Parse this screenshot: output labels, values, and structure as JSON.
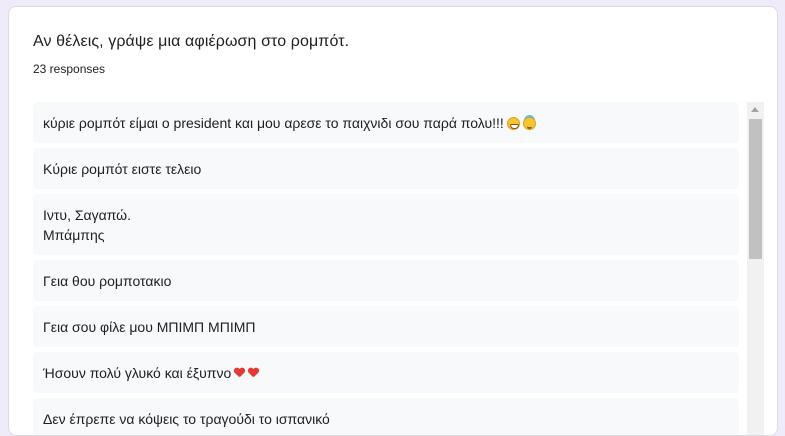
{
  "question": {
    "title": "Αν θέλεις, γράψε μια αφιέρωση στο ρομπότ.",
    "response_count": "23 responses"
  },
  "responses": [
    {
      "text": "κύριε ρομπότ είμαι ο president και μου αρεσε το παιχνιδι σου παρά πολυ!!!",
      "emoji": [
        "grinning-face-icon",
        "smiling-face-with-halo-icon"
      ]
    },
    {
      "text": "Κύριε ρομπότ ειστε τελειο"
    },
    {
      "text": "Ιντυ, Σαγαπώ.\nΜπάμπης"
    },
    {
      "text": "Γεια θου ρομποτακιο"
    },
    {
      "text": "Γεια σου φίλε μου ΜΠΙΜΠ ΜΠΙΜΠ"
    },
    {
      "text": "Ήσουν πολύ γλυκό και έξυπνο",
      "emoji": [
        "red-heart-icon",
        "red-heart-icon"
      ]
    },
    {
      "text": "Δεν έπρεπε να κόψεις το τραγούδι το ισπανικό"
    }
  ],
  "colors": {
    "background": "#f0ebf8",
    "card": "#ffffff",
    "row": "#f8f9fa",
    "text": "#202124"
  }
}
